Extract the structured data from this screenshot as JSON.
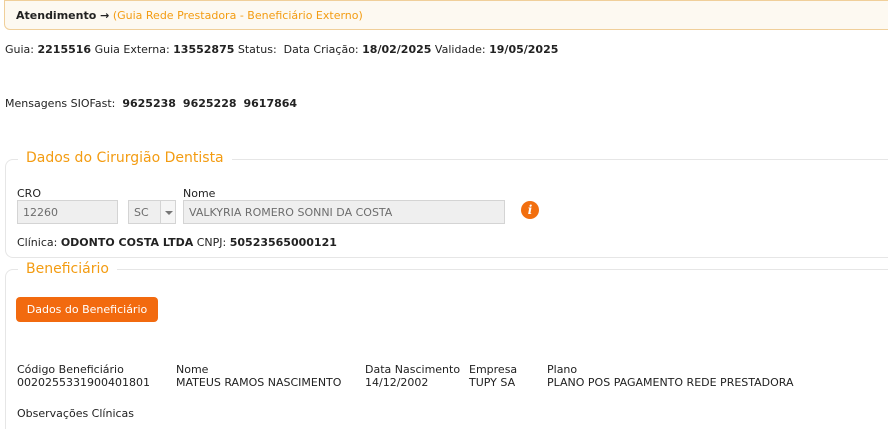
{
  "breadcrumb": {
    "main": "Atendimento →",
    "sub": "(Guia Rede Prestadora - Beneficiário Externo)"
  },
  "guide_info": {
    "guia_label": "Guia:",
    "guia_value": "2215516",
    "externa_label": "Guia Externa:",
    "externa_value": "13552875",
    "status_label": "Status:",
    "criacao_label": "Data Criação:",
    "criacao_value": "18/02/2025",
    "validade_label": "Validade:",
    "validade_value": "19/05/2025"
  },
  "messages": {
    "label": "Mensagens SIOFast:",
    "codes": [
      "9625238",
      "9625228",
      "9617864"
    ]
  },
  "dentist": {
    "legend": "Dados do Cirurgião Dentista",
    "cro_label": "CRO",
    "cro_value": "12260",
    "uf_value": "SC",
    "nome_label": "Nome",
    "nome_value": "VALKYRIA ROMERO SONNI DA COSTA",
    "info_icon": "info-icon",
    "clinica_label": "Clínica:",
    "clinica_value": "ODONTO COSTA LTDA",
    "cnpj_label": "CNPJ:",
    "cnpj_value": "50523565000121"
  },
  "beneficiary": {
    "legend": "Beneficiário",
    "button_label": "Dados do Beneficiário",
    "columns": [
      {
        "header": "Código Beneficiário",
        "value": "0020255331900401801"
      },
      {
        "header": "Nome",
        "value": "MATEUS RAMOS NASCIMENTO"
      },
      {
        "header": "Data Nascimento",
        "value": "14/12/2002"
      },
      {
        "header": "Empresa",
        "value": "TUPY SA"
      },
      {
        "header": "Plano",
        "value": "PLANO POS PAGAMENTO REDE PRESTADORA"
      }
    ],
    "obs_label": "Observações Clínicas"
  },
  "colors": {
    "accent": "#f39c12",
    "button": "#f26a0f"
  }
}
